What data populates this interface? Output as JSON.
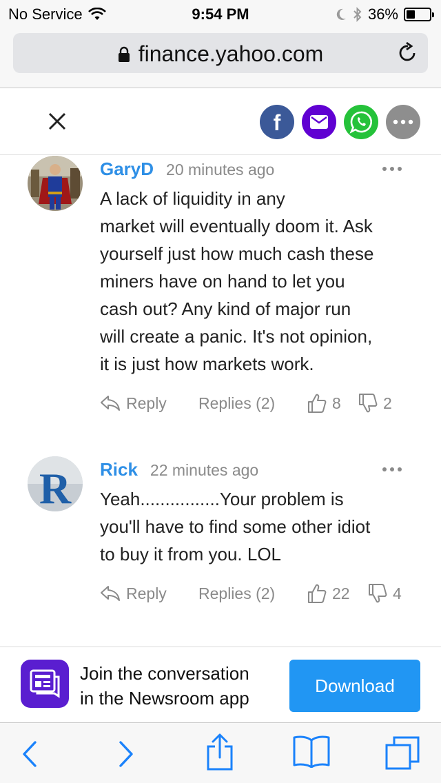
{
  "status_bar": {
    "carrier": "No Service",
    "time": "9:54 PM",
    "battery_percent": "36%",
    "battery_level": 0.36
  },
  "browser": {
    "url": "finance.yahoo.com"
  },
  "comments": [
    {
      "author": "GaryD",
      "time": "20 minutes ago",
      "lines": [
        "A lack of liquidity in any",
        "market will eventually doom it. Ask",
        "yourself just how much cash these",
        "miners have on hand to let you",
        "cash out? Any kind of major run",
        "will create a panic. It's not opinion,",
        "it is just how markets work."
      ],
      "reply_label": "Reply",
      "replies_label": "Replies (2)",
      "upvotes": "8",
      "downvotes": "2"
    },
    {
      "author": "Rick",
      "time": "22 minutes ago",
      "lines": [
        "Yeah................Your problem is",
        "you'll have to find some other idiot",
        "to buy it from you. LOL"
      ],
      "avatar_letter": "R",
      "reply_label": "Reply",
      "replies_label": "Replies (2)",
      "upvotes": "22",
      "downvotes": "4"
    }
  ],
  "banner": {
    "line1": "Join the conversation",
    "line2": "in the Newsroom app",
    "download_label": "Download"
  },
  "colors": {
    "accent": "#2196f3",
    "author": "#2e8fe6",
    "facebook": "#3b5998",
    "email": "#6001d2",
    "whatsapp": "#25c23a",
    "more": "#8e8e8e",
    "ios_blue": "#1a82fb"
  }
}
